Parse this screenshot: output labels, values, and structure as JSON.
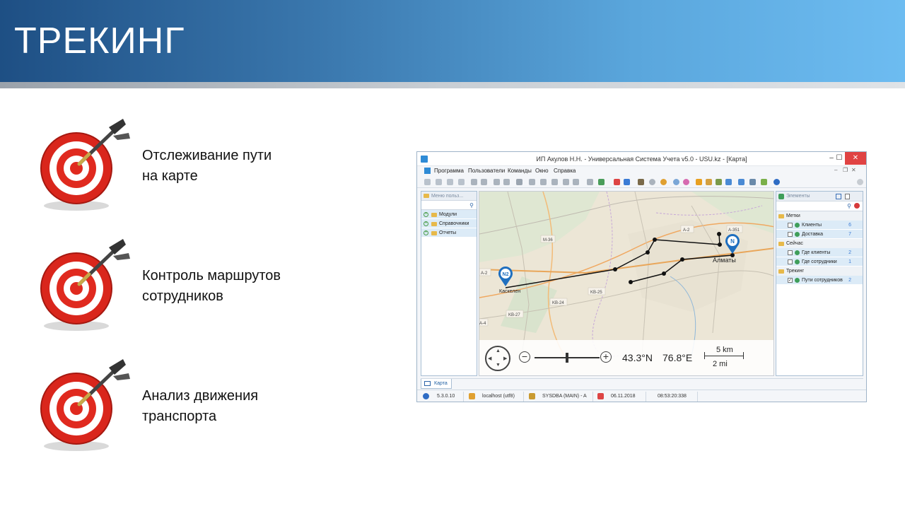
{
  "slide": {
    "title": "ТРЕКИНГ",
    "features": [
      {
        "line1": "Отслеживание пути",
        "line2": "на карте"
      },
      {
        "line1": "Контроль маршрутов",
        "line2": "сотрудников"
      },
      {
        "line1": "Анализ движения",
        "line2": "транспорта"
      }
    ]
  },
  "window": {
    "title": "ИП Акулов Н.Н. - Универсальная Система Учета v5.0 - USU.kz - [Карта]",
    "controls": {
      "minimize": "–",
      "maximize": "☐",
      "close": "✕"
    },
    "menu": [
      "Программа",
      "Пользователи",
      "Команды",
      "Окно",
      "Справка"
    ],
    "mdi_controls": {
      "minimize": "–",
      "restore": "❐",
      "close": "✕"
    },
    "left_panel": {
      "title": "Меню польз...",
      "items": [
        "Модули",
        "Справочники",
        "Отчеты"
      ]
    },
    "map": {
      "road_labels": [
        "M-36",
        "A-2",
        "A-351",
        "A-2",
        "KB-25",
        "KB-24",
        "KB-27",
        "A-4"
      ],
      "cities": [
        "Алматы",
        "Каскелен"
      ],
      "markers": [
        "N",
        "N2"
      ],
      "latitude": "43.3°N",
      "longitude": "76.8°E",
      "scale_km": "5 km",
      "scale_mi": "2 mi"
    },
    "right_panel": {
      "title": "Элементы",
      "groups": [
        {
          "name": "Метки",
          "items": [
            {
              "label": "Клиенты",
              "count": "6",
              "checked": false
            },
            {
              "label": "Доставка",
              "count": "7",
              "checked": false
            }
          ]
        },
        {
          "name": "Сейчас",
          "items": [
            {
              "label": "Где клиенты",
              "count": "2",
              "checked": false
            },
            {
              "label": "Где сотрудники",
              "count": "1",
              "checked": false
            }
          ]
        },
        {
          "name": "Трекинг",
          "items": [
            {
              "label": "Пути сотрудников",
              "count": "2",
              "checked": true
            }
          ]
        }
      ]
    },
    "tab": "Карта",
    "status": {
      "version": "5.3.0.10",
      "server": "localhost (utf8)",
      "user": "SYSDBA (MAIN) - A",
      "date": "06.11.2018",
      "time": "08:53:20:338"
    }
  },
  "colors": {
    "banner_dark": "#1e4f84",
    "banner_light": "#6dbcf1",
    "target_red": "#e02a1f",
    "accent_blue": "#2e8bd6",
    "route_black": "#000000"
  }
}
